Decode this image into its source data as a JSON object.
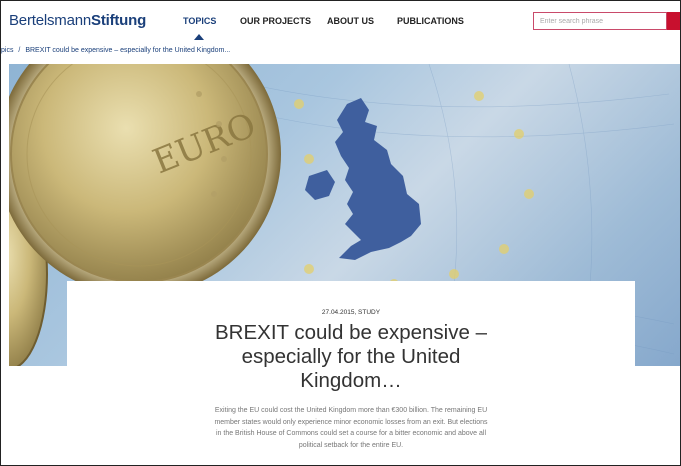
{
  "header": {
    "logo_light": "Bertelsmann",
    "logo_bold": "Stiftung",
    "nav": [
      "TOPICS",
      "OUR PROJECTS",
      "ABOUT US",
      "PUBLICATIONS"
    ],
    "active_nav": "TOPICS",
    "search_placeholder": "Enter search phrase"
  },
  "breadcrumb": {
    "root": "pics",
    "separator": "/",
    "current": "BREXIT could be expensive – especially for the United Kingdom..."
  },
  "hero": {
    "coin_text": "EURO"
  },
  "article": {
    "meta": "27.04.2015, STUDY",
    "title_lines": [
      "BREXIT could be expensive –",
      "especially for the United",
      "Kingdom…"
    ],
    "teaser_lines": [
      "Exiting the EU could cost the United Kingdom more than €300 billion. The remaining EU",
      "member states would only experience minor economic losses from an exit. But elections",
      "in the British House of Commons could set a course for a bitter economic and above all",
      "political setback for the entire EU."
    ]
  },
  "colors": {
    "brand": "#1a3f7a",
    "accent": "#c8102e"
  }
}
